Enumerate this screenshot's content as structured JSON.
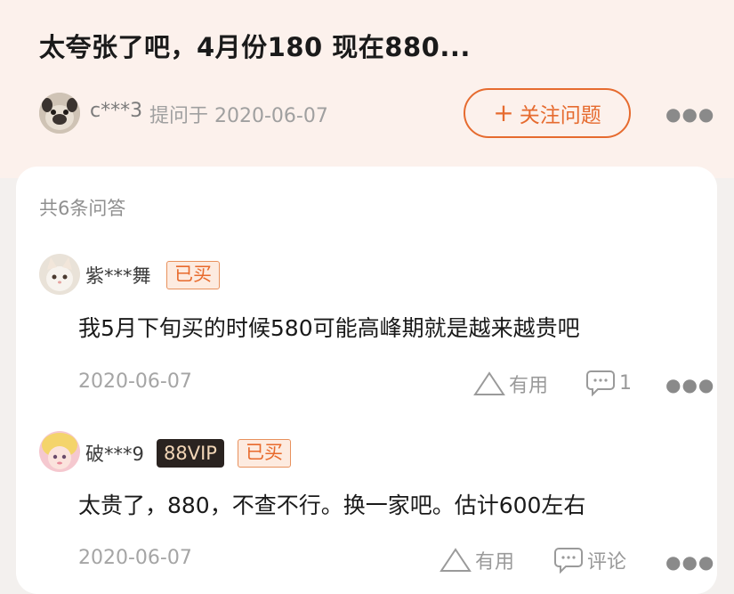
{
  "question": {
    "title": "太夸张了吧，4月份180 现在880...",
    "asker_name": "c***3",
    "asker_action": "提问于 2020-06-07",
    "follow_label": "关注问题",
    "more_icon": "more-horizontal-icon"
  },
  "answers_section": {
    "count_label": "共6条问答",
    "items": [
      {
        "user": "紫***舞",
        "badges": {
          "bought": "已买"
        },
        "text": "我5月下旬买的时候580可能高峰期就是越来越贵吧",
        "date": "2020-06-07",
        "useful_label": "有用",
        "comment_count": "1"
      },
      {
        "user": "破***9",
        "badges": {
          "vip": "88VIP",
          "bought": "已买"
        },
        "text": "太贵了，880，不查不行。换一家吧。估计600左右",
        "date": "2020-06-07",
        "useful_label": "有用",
        "comment_label": "评论"
      }
    ]
  },
  "colors": {
    "accent": "#e66b2f",
    "header_bg": "#fcf1ec",
    "vip_bg": "#2a2320",
    "vip_text": "#f2d6b7"
  }
}
